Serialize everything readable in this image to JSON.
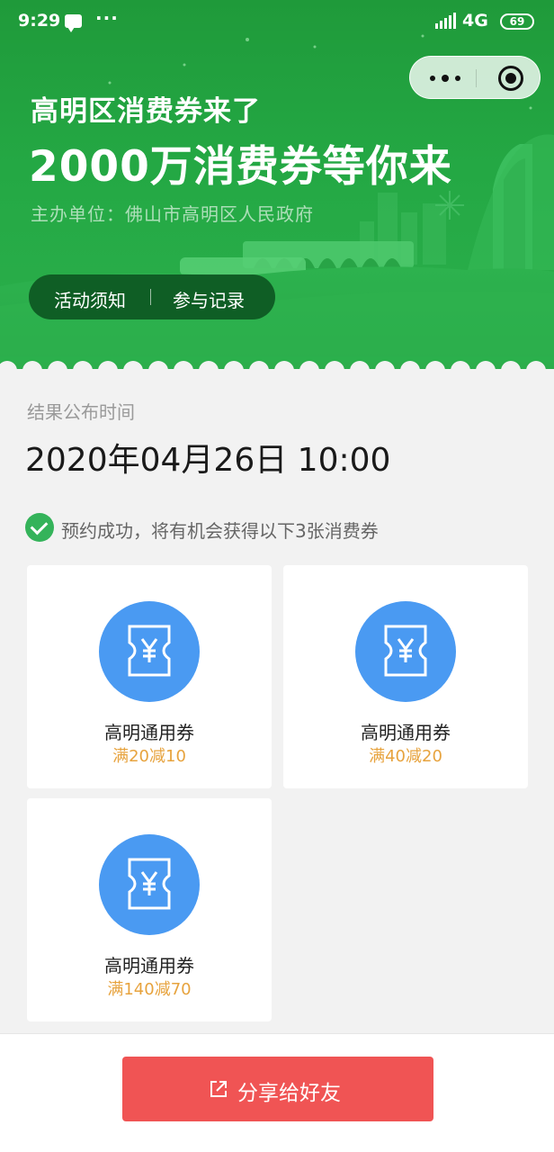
{
  "status_bar": {
    "time": "9:29",
    "more": "···",
    "network": "4G",
    "battery": "69",
    "icons": [
      "message-icon",
      "signal-icon"
    ]
  },
  "mini_program": {
    "more_icon": "more-dots-icon",
    "close_icon": "circle-close-icon"
  },
  "banner": {
    "subtitle": "高明区消费券来了",
    "title": "2000万消费券等你来",
    "organizer": "主办单位：佛山市高明区人民政府",
    "links": {
      "rules": "活动须知",
      "separator": "|",
      "records": "参与记录"
    },
    "colors": {
      "primary": "#24a844",
      "dark": "#0a501e"
    }
  },
  "result": {
    "label": "结果公布时间",
    "time": "2020年04月26日 10:00"
  },
  "notice": {
    "icon": "check-circle-icon",
    "text": "预约成功，将有机会获得以下3张消费券"
  },
  "coupons": [
    {
      "icon": "yuan-ticket-icon",
      "name": "高明通用券",
      "condition": "满20减10"
    },
    {
      "icon": "yuan-ticket-icon",
      "name": "高明通用券",
      "condition": "满40减20"
    },
    {
      "icon": "yuan-ticket-icon",
      "name": "高明通用券",
      "condition": "满140减70"
    }
  ],
  "share": {
    "icon": "share-external-icon",
    "label": "分享给好友",
    "color": "#f05454"
  },
  "colors": {
    "coupon_circle": "#4a9af2",
    "condition_text": "#e7a33e",
    "success": "#34b35a"
  }
}
